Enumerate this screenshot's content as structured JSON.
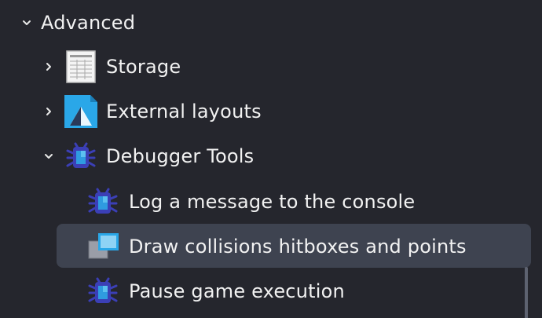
{
  "tree": {
    "advanced": {
      "label": "Advanced",
      "expanded": true,
      "chevron_icon": "chevron-down-icon"
    },
    "storage": {
      "label": "Storage",
      "icon": "storage-icon",
      "chevron_icon": "chevron-right-icon"
    },
    "external_layouts": {
      "label": "External layouts",
      "icon": "external-layouts-icon",
      "chevron_icon": "chevron-right-icon"
    },
    "debugger_tools": {
      "label": "Debugger Tools",
      "icon": "bug-icon",
      "expanded": true,
      "chevron_icon": "chevron-down-icon",
      "children": [
        {
          "label": "Log a message to the console",
          "icon": "bug-icon"
        },
        {
          "label": "Draw collisions hitboxes and points",
          "icon": "hitbox-icon",
          "selected": true
        },
        {
          "label": "Pause game execution",
          "icon": "bug-icon"
        }
      ]
    }
  },
  "colors": {
    "background": "#25262d",
    "selected_row": "#3e4350",
    "text": "#f2f2f2",
    "accent_blue": "#2aa7e8"
  }
}
